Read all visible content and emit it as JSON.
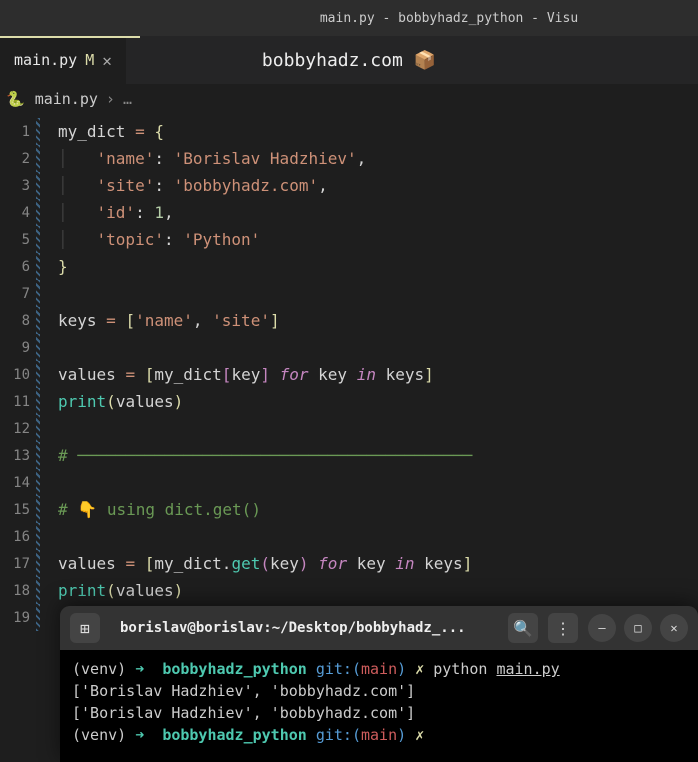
{
  "window": {
    "title": "main.py - bobbyhadz_python - Visu"
  },
  "tab": {
    "filename": "main.py",
    "modified_indicator": "M",
    "close": "✕"
  },
  "center_badge": "bobbyhadz.com 📦",
  "breadcrumb": {
    "icon": "🐍",
    "file": "main.py",
    "sep": "›",
    "dots": "…"
  },
  "code": {
    "line1": "my_dict = {",
    "line2": "    'name': 'Borislav Hadzhiev',",
    "line3": "    'site': 'bobbyhadz.com',",
    "line4": "    'id': 1,",
    "line5": "    'topic': 'Python'",
    "line6": "}",
    "line7": "",
    "line8": "keys = ['name', 'site']",
    "line9": "",
    "line10": "values = [my_dict[key] for key in keys]",
    "line11": "print(values)",
    "line12": "",
    "line13": "# ─────────────────────────────────────────",
    "line14": "",
    "line15": "# 👇 using dict.get()",
    "line16": "",
    "line17": "values = [my_dict.get(key) for key in keys]",
    "line18": "print(values)",
    "line19": ""
  },
  "line_numbers": [
    "1",
    "2",
    "3",
    "4",
    "5",
    "6",
    "7",
    "8",
    "9",
    "10",
    "11",
    "12",
    "13",
    "14",
    "15",
    "16",
    "17",
    "18",
    "19"
  ],
  "terminal": {
    "title": "borislav@borislav:~/Desktop/bobbyhadz_...",
    "prompt": {
      "venv": "(venv)",
      "arrow": "➜",
      "path": "bobbyhadz_python",
      "git_prefix": "git:(",
      "branch": "main",
      "git_suffix": ")",
      "lightning": "✗",
      "cmd": "python",
      "file": "main.py"
    },
    "output1": "['Borislav Hadzhiev', 'bobbyhadz.com']",
    "output2": "['Borislav Hadzhiev', 'bobbyhadz.com']"
  }
}
